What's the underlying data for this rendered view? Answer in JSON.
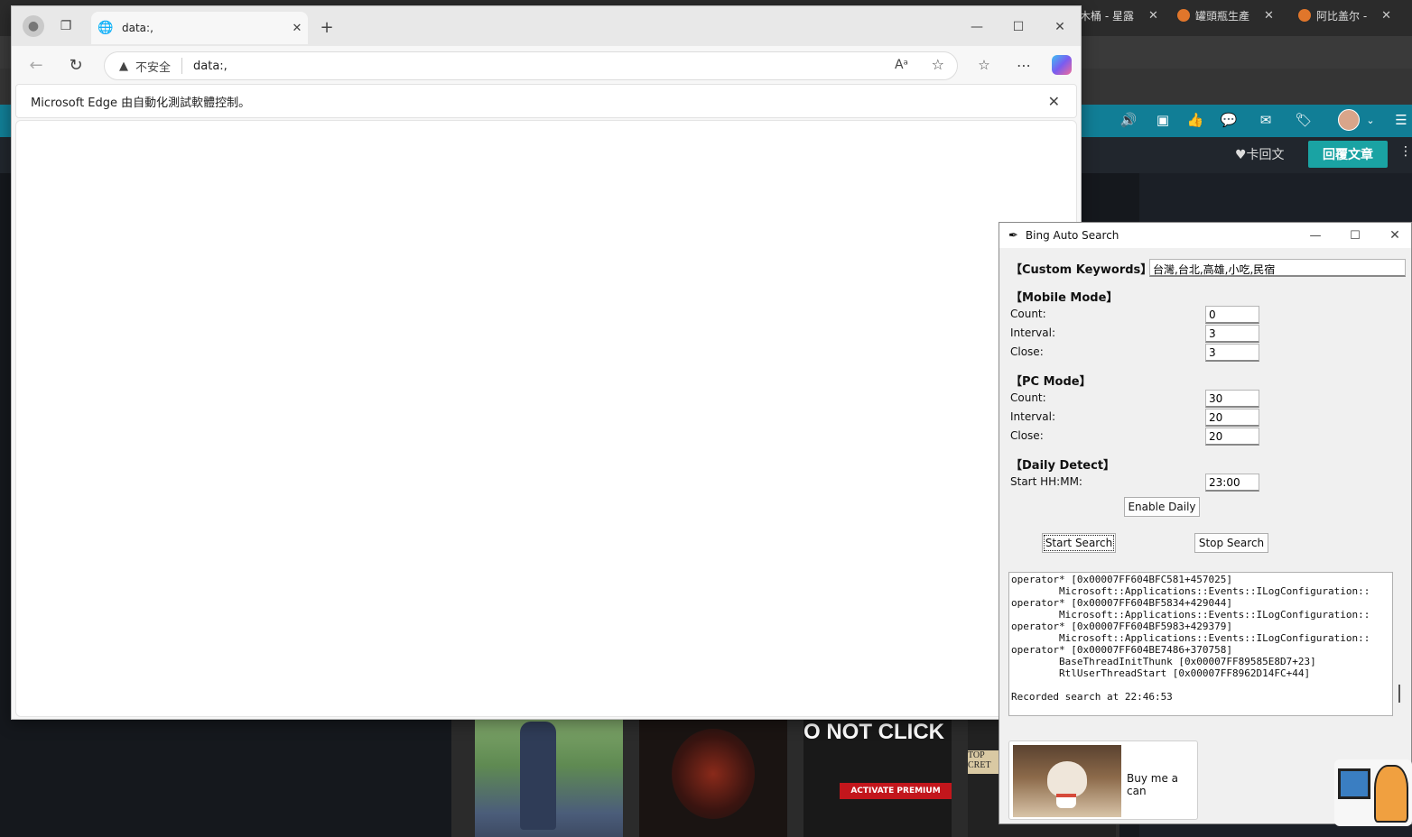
{
  "background": {
    "tabs": [
      {
        "label": "木桶 - 星露"
      },
      {
        "label": "罐頭瓶生產"
      },
      {
        "label": "阿比盖尔 -"
      }
    ],
    "actions": {
      "favorite_label": "♥卡回文",
      "reply_label": "回覆文章"
    }
  },
  "edge": {
    "tab_title": "data:,",
    "security_label": "不安全",
    "address": "data:,",
    "infobar_text": "Microsoft Edge 由自動化測試軟體控制。"
  },
  "app": {
    "title": "Bing Auto Search",
    "custom_keywords": {
      "label": "【Custom Keywords】",
      "value": "台灣,台北,高雄,小吃,民宿"
    },
    "mobile": {
      "header": "【Mobile Mode】",
      "count_label": "Count:",
      "count": "0",
      "interval_label": "Interval:",
      "interval": "3",
      "close_label": "Close:",
      "close": "3"
    },
    "pc": {
      "header": "【PC Mode】",
      "count_label": "Count:",
      "count": "30",
      "interval_label": "Interval:",
      "interval": "20",
      "close_label": "Close:",
      "close": "20"
    },
    "daily": {
      "header": "【Daily Detect】",
      "start_label": "Start HH:MM:",
      "start": "23:00",
      "enable_label": "Enable Daily"
    },
    "start_search_label": "Start Search",
    "stop_search_label": "Stop Search",
    "log_text": "operator* [0x00007FF604BFC581+457025]\n        Microsoft::Applications::Events::ILogConfiguration::\noperator* [0x00007FF604BF5834+429044]\n        Microsoft::Applications::Events::ILogConfiguration::\noperator* [0x00007FF604BF5983+429379]\n        Microsoft::Applications::Events::ILogConfiguration::\noperator* [0x00007FF604BE7486+370758]\n        BaseThreadInitThunk [0x00007FF89585E8D7+23]\n        RtlUserThreadStart [0x00007FF8962D14FC+44]\n\nRecorded search at 22:46:53",
    "donate_label": "Buy me a can"
  },
  "thumbnails": {
    "promo_text": "O NOT CLICK",
    "activate_label": "ACTIVATE PREMIUM",
    "secret_text": "TOP CRET"
  }
}
